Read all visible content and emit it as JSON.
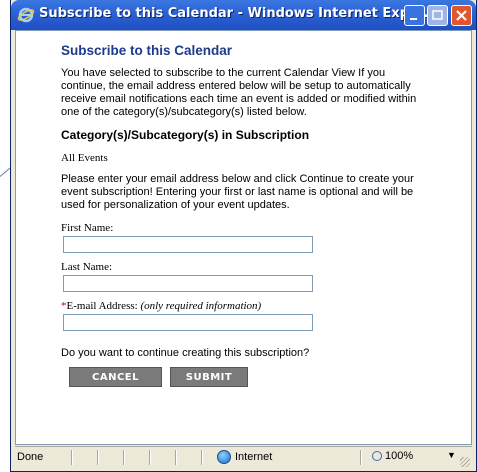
{
  "window": {
    "title": "Subscribe to this Calendar - Windows Internet Expl..."
  },
  "page": {
    "heading": "Subscribe to this Calendar",
    "intro": "You have selected to subscribe to the current Calendar View If you continue, the email address entered below will be setup to automatically receive email notifications each time an event is added or modified within one of the category(s)/subcategory(s) listed below.",
    "categories_heading": "Category(s)/Subcategory(s) in Subscription",
    "categories_value": "All Events",
    "prompt": "Please enter your email address below and click Continue to create your event subscription! Entering your first or last name is optional and will be used for personalization of your event updates.",
    "first_name_label": "First Name:",
    "first_name_value": "",
    "last_name_label": "Last Name:",
    "last_name_value": "",
    "email_required_marker": "*",
    "email_label": "E-mail Address:",
    "email_note": "(only required information)",
    "email_value": "",
    "question": "Do you want to continue creating this subscription?",
    "cancel_label": "CANCEL",
    "submit_label": "SUBMIT"
  },
  "statusbar": {
    "status": "Done",
    "zone": "Internet",
    "zoom": "100%",
    "zoom_dropdown": "▼"
  },
  "colors": {
    "title_bar": "#2c63d6",
    "heading": "#1e3a8a",
    "button": "#7a7a7a",
    "required": "#cc0000"
  }
}
